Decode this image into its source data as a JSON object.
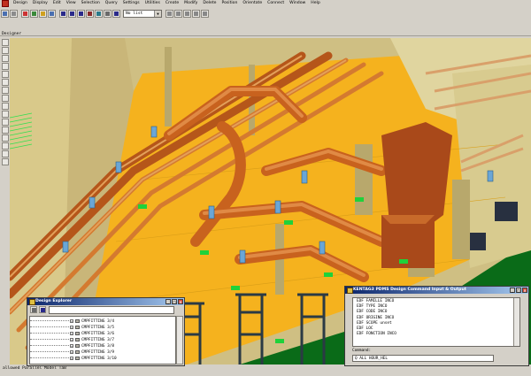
{
  "menu": [
    "Design",
    "Display",
    "Edit",
    "View",
    "Selection",
    "Query",
    "Settings",
    "Utilities",
    "Create",
    "Modify",
    "Delete",
    "Position",
    "Orientate",
    "Connect",
    "Window",
    "Help"
  ],
  "toolbar": {
    "list_value": "No list"
  },
  "view_title": "Designer",
  "status": {
    "text": "allowed Parallel Model TaB"
  },
  "design_explorer": {
    "title": "Design Explorer",
    "items": [
      "CMPFITTING 3/4",
      "CMPFITTING 3/5",
      "CMPFITTING 3/6",
      "CMPFITTING 3/7",
      "CMPFITTING 3/8",
      "CMPFITTING 3/9",
      "CMPFITTING 3/10"
    ]
  },
  "command_window": {
    "title": "KENTAG3 PDMS Design Command Input & Output",
    "lines": [
      "EDF FAMILLE INCO",
      "EDF TYPE INCO",
      "EDF CODE INCO",
      "EDF ORIGINE INCO",
      "EDF SCOPE unset",
      "EDF LOC",
      "EDF FONCTION INCO"
    ],
    "command_label": "Command:",
    "command_value": "Q ALL HOUR_HEL"
  },
  "icons": {
    "app": "pdms-app-icon",
    "close": "close-icon",
    "minimize": "minimize-icon",
    "maximize": "maximize-icon"
  },
  "colors": {
    "floor": "#f5b21e",
    "pipe": "#c8621e",
    "structure": "#d9c98a",
    "steel": "#2b3a44",
    "support": "#1fd23a",
    "valve": "#6aa6d6",
    "title_active": "#0a246a"
  }
}
